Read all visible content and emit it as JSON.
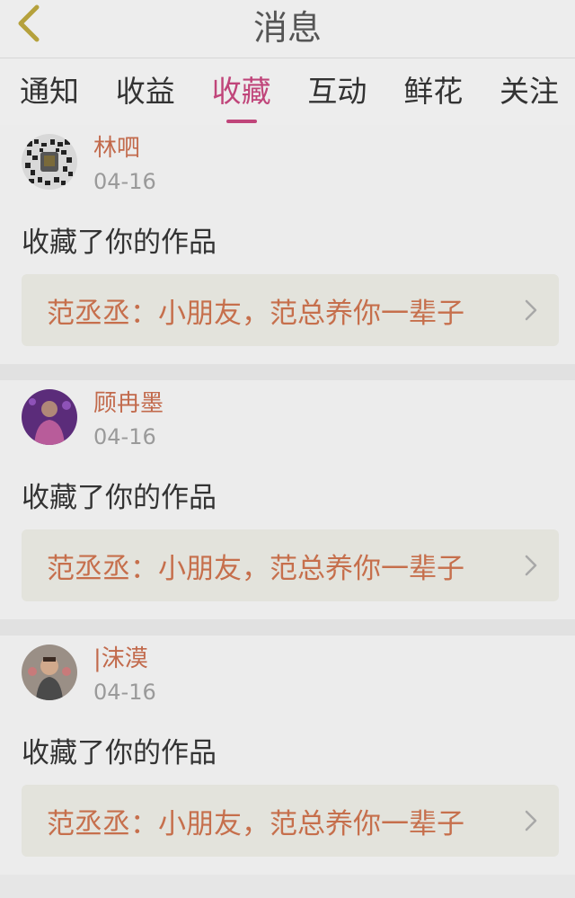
{
  "header": {
    "title": "消息",
    "back_icon": "chevron-left-icon"
  },
  "tabs": [
    {
      "label": "通知",
      "active": false
    },
    {
      "label": "收益",
      "active": false
    },
    {
      "label": "收藏",
      "active": true
    },
    {
      "label": "互动",
      "active": false
    },
    {
      "label": "鲜花",
      "active": false
    },
    {
      "label": "关注",
      "active": false
    }
  ],
  "colors": {
    "accent": "#c0457a",
    "username": "#c26a4c",
    "work_text": "#c66f4c"
  },
  "notifications": [
    {
      "username": "林呬",
      "date": "04-16",
      "action": "收藏了你的作品",
      "work_title": "范丞丞：小朋友，范总养你一辈子",
      "avatar": "qr-avatar"
    },
    {
      "username": "顾冉墨",
      "date": "04-16",
      "action": "收藏了你的作品",
      "work_title": "范丞丞：小朋友，范总养你一辈子",
      "avatar": "purple-stage-avatar"
    },
    {
      "username": "|沫漠",
      "date": "04-16",
      "action": "收藏了你的作品",
      "work_title": "范丞丞：小朋友，范总养你一辈子",
      "avatar": "child-avatar"
    }
  ]
}
